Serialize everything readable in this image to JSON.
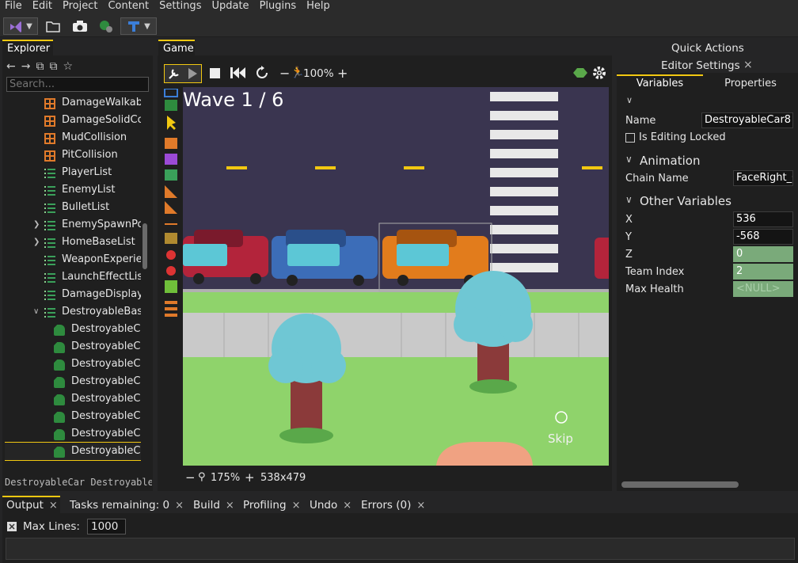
{
  "menu": [
    "File",
    "Edit",
    "Project",
    "Content",
    "Settings",
    "Update",
    "Plugins",
    "Help"
  ],
  "explorer": {
    "tab": "Explorer",
    "search_placeholder": "Search...",
    "items": [
      {
        "label": "DamageWalkab",
        "icon": "grid-icon",
        "indent": 1,
        "expander": ""
      },
      {
        "label": "DamageSolidCo",
        "icon": "grid-icon",
        "indent": 1,
        "expander": ""
      },
      {
        "label": "MudCollision",
        "icon": "grid-icon",
        "indent": 1,
        "expander": ""
      },
      {
        "label": "PitCollision",
        "icon": "grid-icon",
        "indent": 1,
        "expander": ""
      },
      {
        "label": "PlayerList",
        "icon": "list-icon",
        "indent": 1,
        "expander": ""
      },
      {
        "label": "EnemyList",
        "icon": "list-icon",
        "indent": 1,
        "expander": ""
      },
      {
        "label": "BulletList",
        "icon": "list-icon",
        "indent": 1,
        "expander": ""
      },
      {
        "label": "EnemySpawnPo",
        "icon": "list-icon",
        "indent": 1,
        "expander": ">"
      },
      {
        "label": "HomeBaseList",
        "icon": "list-icon",
        "indent": 1,
        "expander": ">"
      },
      {
        "label": "WeaponExperie",
        "icon": "list-icon",
        "indent": 1,
        "expander": ""
      },
      {
        "label": "LaunchEffectLis",
        "icon": "list-icon",
        "indent": 1,
        "expander": ""
      },
      {
        "label": "DamageDisplay",
        "icon": "list-icon",
        "indent": 1,
        "expander": ""
      },
      {
        "label": "DestroyableBas",
        "icon": "list-icon",
        "indent": 1,
        "expander": "v"
      },
      {
        "label": "DestroyableCa",
        "icon": "entity-icon",
        "indent": 2,
        "expander": ""
      },
      {
        "label": "DestroyableCa",
        "icon": "entity-icon",
        "indent": 2,
        "expander": ""
      },
      {
        "label": "DestroyableCa",
        "icon": "entity-icon",
        "indent": 2,
        "expander": ""
      },
      {
        "label": "DestroyableCa",
        "icon": "entity-icon",
        "indent": 2,
        "expander": ""
      },
      {
        "label": "DestroyableCa",
        "icon": "entity-icon",
        "indent": 2,
        "expander": ""
      },
      {
        "label": "DestroyableCa",
        "icon": "entity-icon",
        "indent": 2,
        "expander": ""
      },
      {
        "label": "DestroyableCa",
        "icon": "entity-icon",
        "indent": 2,
        "expander": ""
      },
      {
        "label": "DestroyableCa",
        "icon": "entity-icon",
        "indent": 2,
        "expander": "",
        "selected": true
      }
    ],
    "status": "DestroyableCar Destroyable"
  },
  "game": {
    "tab": "Game",
    "speed": "100%",
    "wave_text": "Wave 1 / 6",
    "skip_label": "Skip",
    "zoom": "175%",
    "resolution": "538x479"
  },
  "right": {
    "quick_actions": "Quick Actions",
    "editor_settings": "Editor Settings",
    "tab_variables": "Variables",
    "tab_properties": "Properties",
    "name_label": "Name",
    "name_value": "DestroyableCar8",
    "editing_locked": "Is Editing Locked",
    "animation_section": "Animation",
    "chain_name_label": "Chain Name",
    "chain_name_value": "FaceRight_C",
    "other_section": "Other Variables",
    "vars": [
      {
        "label": "X",
        "value": "536",
        "disabled": false
      },
      {
        "label": "Y",
        "value": "-568",
        "disabled": false
      },
      {
        "label": "Z",
        "value": "0",
        "disabled": true
      },
      {
        "label": "Team Index",
        "value": "2",
        "disabled": true
      },
      {
        "label": "Max Health",
        "value": "<NULL>",
        "disabled": true
      }
    ]
  },
  "bottom": {
    "tabs": [
      {
        "label": "Output",
        "active": true
      },
      {
        "label": "Tasks remaining: 0",
        "active": false
      },
      {
        "label": "Build",
        "active": false
      },
      {
        "label": "Profiling",
        "active": false
      },
      {
        "label": "Undo",
        "active": false
      },
      {
        "label": "Errors (0)",
        "active": false
      }
    ],
    "max_lines_label": "Max Lines:",
    "max_lines_value": "1000"
  },
  "colors": {
    "accent": "#f2c811",
    "grass": "#8fd36b",
    "road": "#3a3550"
  }
}
